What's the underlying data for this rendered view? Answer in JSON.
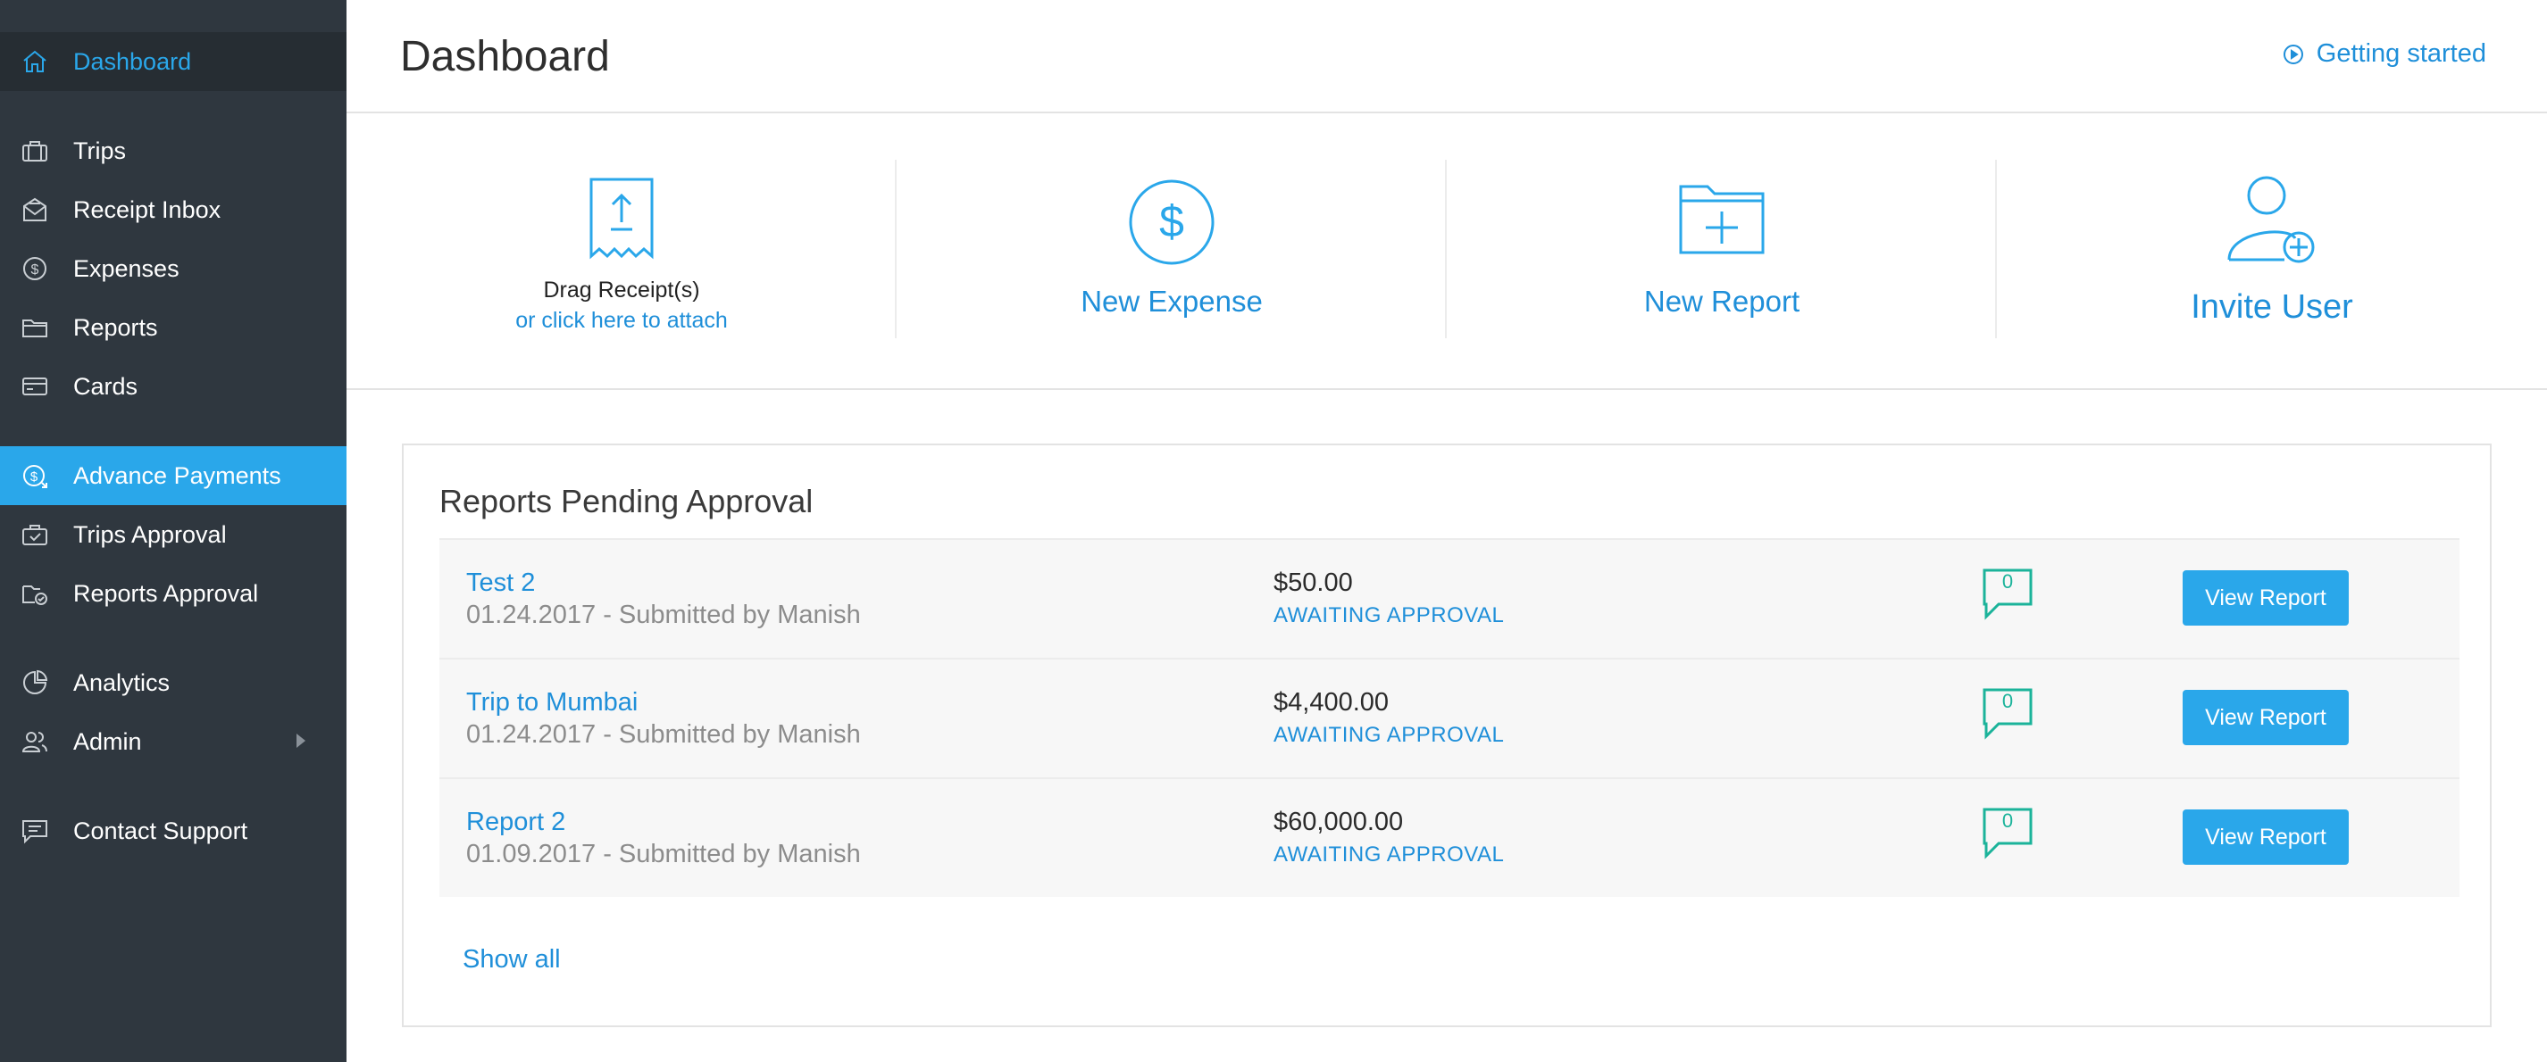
{
  "sidebar": {
    "items": [
      {
        "label": "Dashboard",
        "icon": "home-icon"
      },
      {
        "label": "Trips",
        "icon": "briefcase-icon"
      },
      {
        "label": "Receipt Inbox",
        "icon": "inbox-icon"
      },
      {
        "label": "Expenses",
        "icon": "dollar-circle-icon"
      },
      {
        "label": "Reports",
        "icon": "folder-icon"
      },
      {
        "label": "Cards",
        "icon": "card-icon"
      },
      {
        "label": "Advance Payments",
        "icon": "advance-payment-icon"
      },
      {
        "label": "Trips Approval",
        "icon": "briefcase-check-icon"
      },
      {
        "label": "Reports Approval",
        "icon": "folder-check-icon"
      },
      {
        "label": "Analytics",
        "icon": "pie-chart-icon"
      },
      {
        "label": "Admin",
        "icon": "users-icon"
      },
      {
        "label": "Contact Support",
        "icon": "chat-icon"
      }
    ]
  },
  "header": {
    "title": "Dashboard",
    "getting_started": "Getting started"
  },
  "actions": {
    "drag_receipts": "Drag Receipt(s)",
    "click_attach": "or click here to attach",
    "new_expense": "New Expense",
    "new_report": "New Report",
    "invite_user": "Invite User"
  },
  "pending": {
    "title": "Reports Pending Approval",
    "rows": [
      {
        "title": "Test 2",
        "subtitle": "01.24.2017 - Submitted by Manish",
        "amount": "$50.00",
        "status": "AWAITING APPROVAL",
        "comments": "0",
        "button": "View Report"
      },
      {
        "title": "Trip to Mumbai",
        "subtitle": "01.24.2017 - Submitted by Manish",
        "amount": "$4,400.00",
        "status": "AWAITING APPROVAL",
        "comments": "0",
        "button": "View Report"
      },
      {
        "title": "Report 2",
        "subtitle": "01.09.2017 - Submitted by Manish",
        "amount": "$60,000.00",
        "status": "AWAITING APPROVAL",
        "comments": "0",
        "button": "View Report"
      }
    ],
    "show_all": "Show all"
  },
  "colors": {
    "accent": "#2aa7ea",
    "link": "#1f8fd9",
    "sidebar_bg": "#2f373f",
    "comment_green": "#1bb39a"
  }
}
